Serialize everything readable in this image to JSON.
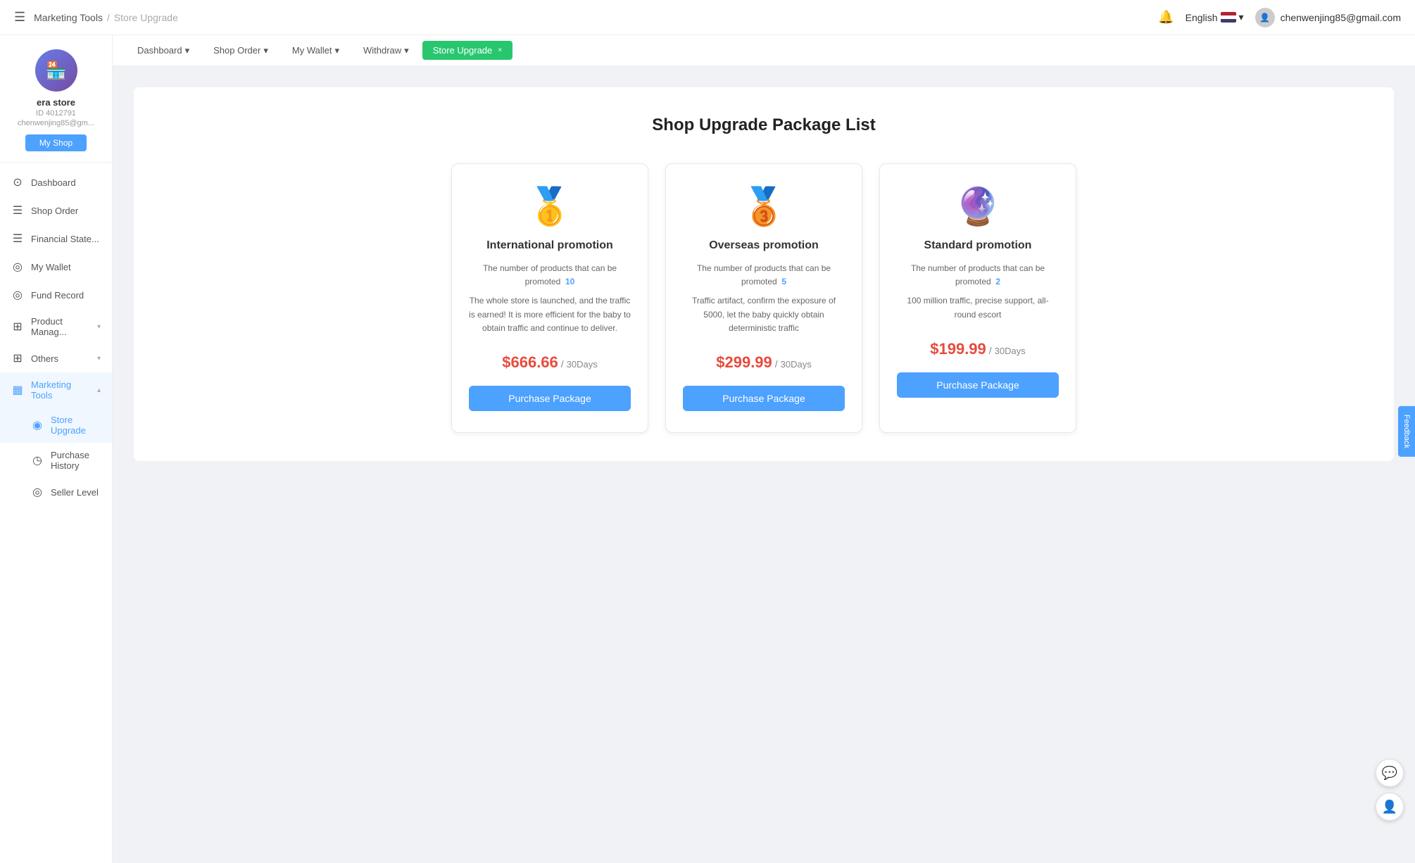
{
  "header": {
    "hamburger_label": "☰",
    "breadcrumb_home": "Marketing Tools",
    "breadcrumb_sep": "/",
    "breadcrumb_current": "Store Upgrade",
    "bell_icon": "🔔",
    "language": "English",
    "user_email": "chenwenjing85@gmail.com"
  },
  "sidebar": {
    "store_name": "era store",
    "store_id": "ID 4012791",
    "store_email": "chenwenjing85@gm...",
    "my_shop_btn": "My Shop",
    "items": [
      {
        "label": "Dashboard",
        "icon": "⊙"
      },
      {
        "label": "Shop Order",
        "icon": "☰"
      },
      {
        "label": "Financial State...",
        "icon": "☰"
      },
      {
        "label": "My Wallet",
        "icon": "◎"
      },
      {
        "label": "Fund Record",
        "icon": "◎"
      },
      {
        "label": "Product Manag...",
        "icon": "⊞",
        "arrow": "▾"
      },
      {
        "label": "Others",
        "icon": "⊞",
        "arrow": "▾"
      },
      {
        "label": "Marketing Tools",
        "icon": "▦",
        "arrow": "▴",
        "active": true
      },
      {
        "label": "Store Upgrade",
        "icon": "◉",
        "sub": true,
        "active": true
      },
      {
        "label": "Purchase History",
        "icon": "◷",
        "sub": true
      },
      {
        "label": "Seller Level",
        "icon": "◎",
        "sub": true
      }
    ]
  },
  "sub_nav": {
    "tabs": [
      {
        "label": "Dashboard",
        "arrow": "▾"
      },
      {
        "label": "Shop Order",
        "arrow": "▾"
      },
      {
        "label": "My Wallet",
        "arrow": "▾"
      },
      {
        "label": "Withdraw",
        "arrow": "▾"
      },
      {
        "label": "Store Upgrade",
        "arrow": "×",
        "active": true
      }
    ]
  },
  "main": {
    "page_title": "Shop Upgrade Package List",
    "packages": [
      {
        "icon": "🥇",
        "name": "International promotion",
        "desc1": "The number of products that can be promoted",
        "promoted_count": "10",
        "desc2": "The whole store is launched, and the traffic is earned! It is more efficient for the baby to obtain traffic and continue to deliver.",
        "price": "$666.66",
        "period": "30Days",
        "btn_label": "Purchase Package"
      },
      {
        "icon": "🥉",
        "name": "Overseas promotion",
        "desc1": "The number of products that can be promoted",
        "promoted_count": "5",
        "desc2": "Traffic artifact, confirm the exposure of 5000, let the baby quickly obtain deterministic traffic",
        "price": "$299.99",
        "period": "30Days",
        "btn_label": "Purchase Package"
      },
      {
        "icon": "🔮",
        "name": "Standard promotion",
        "desc1": "The number of products that can be promoted",
        "promoted_count": "2",
        "desc2": "100 million traffic, precise support, all-round escort",
        "price": "$199.99",
        "period": "30Days",
        "btn_label": "Purchase Package"
      }
    ]
  },
  "floating": {
    "chat_icon": "💬",
    "user_icon": "👤"
  },
  "side_hint": {
    "text": "Feedback"
  }
}
